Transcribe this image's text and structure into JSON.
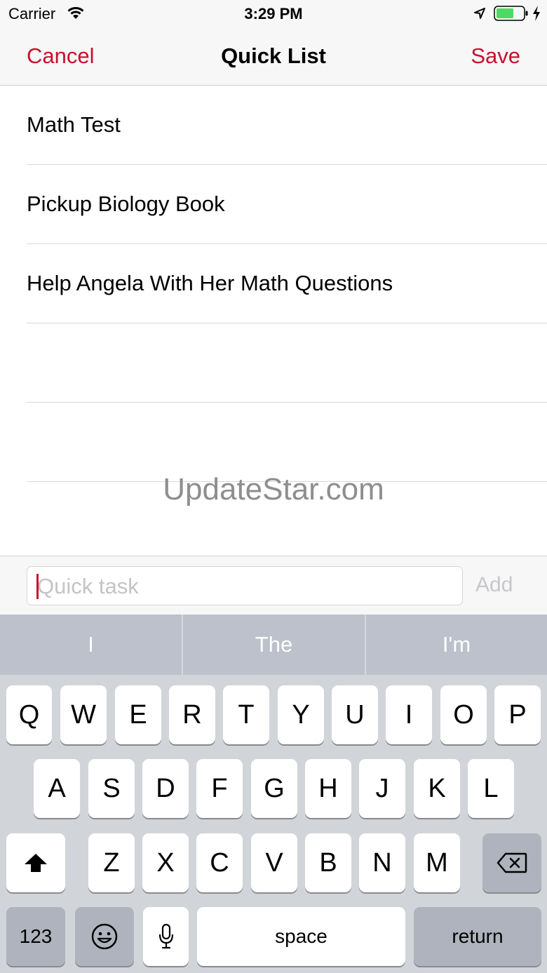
{
  "status_bar": {
    "carrier": "Carrier",
    "time": "3:29 PM",
    "battery_color": "#4cd964"
  },
  "nav": {
    "cancel_label": "Cancel",
    "title": "Quick List",
    "save_label": "Save",
    "accent_color": "#c8102e"
  },
  "tasks": [
    {
      "text": "Math Test"
    },
    {
      "text": "Pickup Biology Book"
    },
    {
      "text": "Help Angela With Her Math Questions"
    },
    {
      "text": ""
    },
    {
      "text": ""
    }
  ],
  "watermark": "UpdateStar.com",
  "input": {
    "placeholder": "Quick task",
    "value": "",
    "add_label": "Add"
  },
  "keyboard": {
    "suggestions": [
      "I",
      "The",
      "I'm"
    ],
    "row1": [
      "Q",
      "W",
      "E",
      "R",
      "T",
      "Y",
      "U",
      "I",
      "O",
      "P"
    ],
    "row2": [
      "A",
      "S",
      "D",
      "F",
      "G",
      "H",
      "J",
      "K",
      "L"
    ],
    "row3": [
      "Z",
      "X",
      "C",
      "V",
      "B",
      "N",
      "M"
    ],
    "numbers_label": "123",
    "space_label": "space",
    "return_label": "return",
    "icons": {
      "shift": "shift-icon",
      "backspace": "backspace-icon",
      "emoji": "emoji-icon",
      "dictation": "microphone-icon"
    }
  }
}
